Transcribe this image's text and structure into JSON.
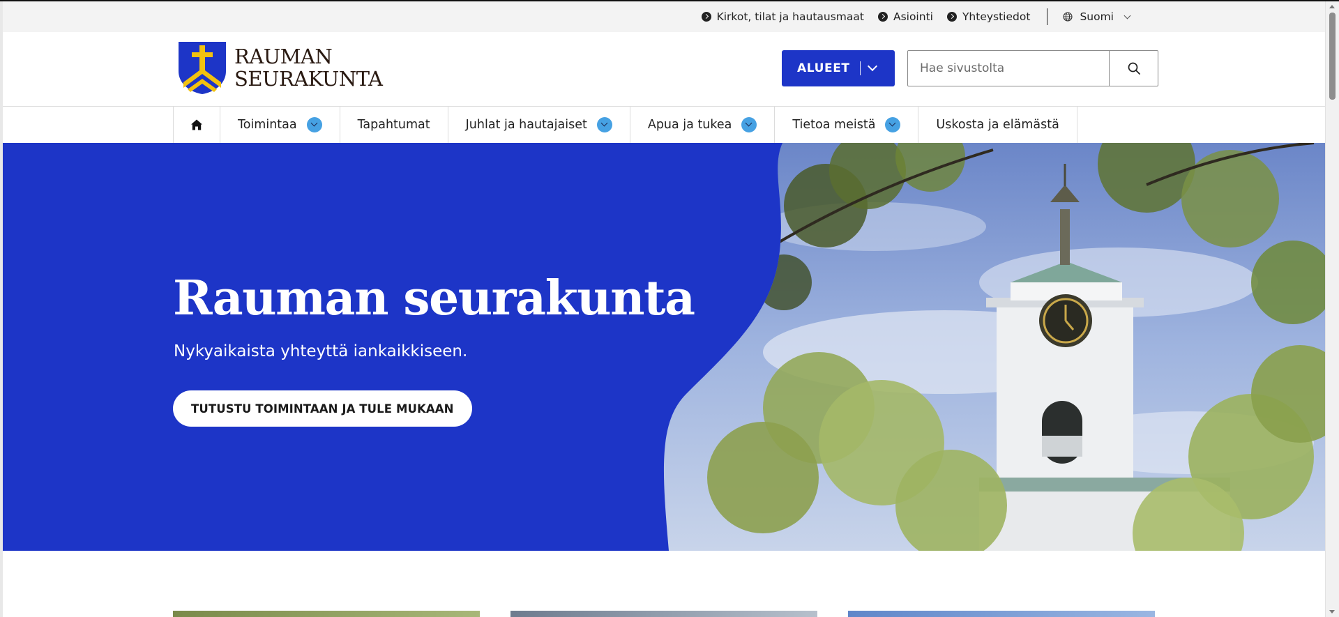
{
  "utility_nav": {
    "links": [
      {
        "label": "Kirkot, tilat ja hautausmaat"
      },
      {
        "label": "Asiointi"
      },
      {
        "label": "Yhteystiedot"
      }
    ],
    "language": "Suomi"
  },
  "header": {
    "logo_line1": "RAUMAN",
    "logo_line2": "SEURAKUNTA",
    "alueet_label": "ALUEET",
    "search_placeholder": "Hae sivustolta"
  },
  "main_nav": {
    "items": [
      {
        "label": "Toimintaa",
        "has_dropdown": true
      },
      {
        "label": "Tapahtumat",
        "has_dropdown": false
      },
      {
        "label": "Juhlat ja hautajaiset",
        "has_dropdown": true
      },
      {
        "label": "Apua ja tukea",
        "has_dropdown": true
      },
      {
        "label": "Tietoa meistä",
        "has_dropdown": true
      },
      {
        "label": "Uskosta ja elämästä",
        "has_dropdown": false
      }
    ]
  },
  "hero": {
    "title": "Rauman seurakunta",
    "subtitle": "Nykyaikaista yhteyttä iankaikkiseen.",
    "cta_label": "TUTUSTU TOIMINTAAN JA TULE MUKAAN"
  },
  "colors": {
    "brand_blue": "#1d35c7",
    "nav_chevron": "#46a1e3",
    "logo_gold": "#f2c20f",
    "logo_shield": "#1d35c7"
  },
  "icons": [
    "home-icon",
    "search-icon",
    "globe-icon",
    "chevron-down-icon",
    "arrow-right-circle-icon",
    "logo-cross-icon"
  ]
}
